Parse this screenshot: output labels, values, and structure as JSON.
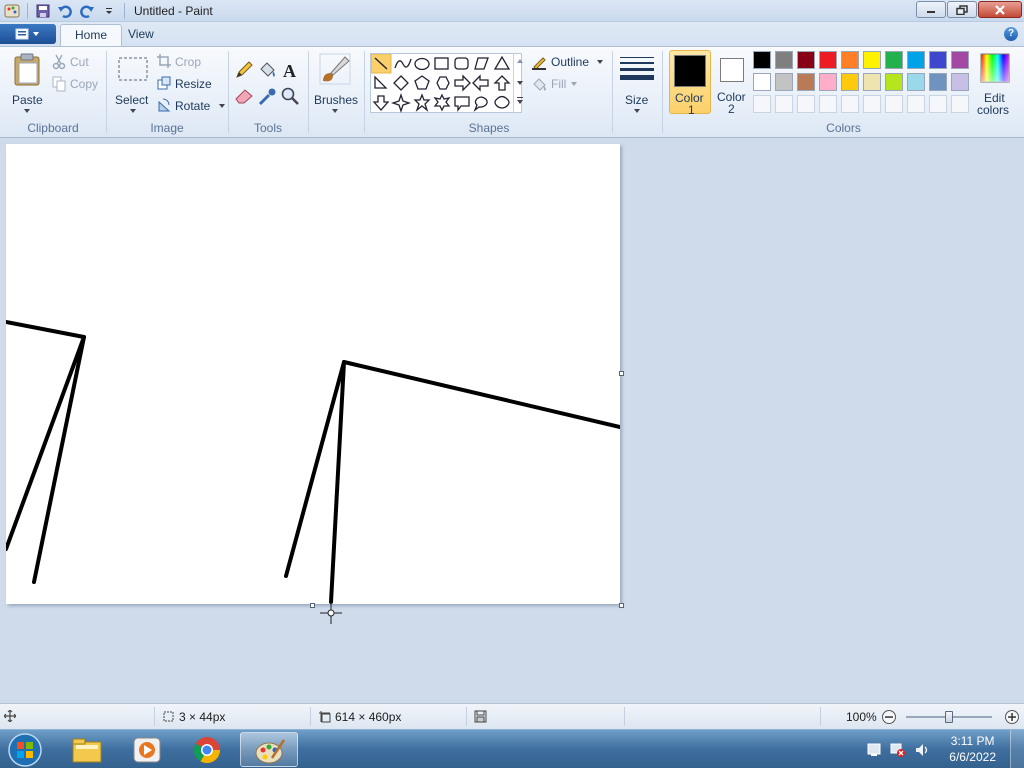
{
  "window": {
    "title": "Untitled - Paint",
    "controls": [
      "minimize-icon",
      "restore-icon",
      "close-icon"
    ]
  },
  "tabs": [
    {
      "label": "Home",
      "active": true
    },
    {
      "label": "View",
      "active": false
    }
  ],
  "ribbon": {
    "clipboard": {
      "label": "Clipboard",
      "paste": "Paste",
      "cut": "Cut",
      "copy": "Copy"
    },
    "image": {
      "label": "Image",
      "select": "Select",
      "crop": "Crop",
      "resize": "Resize",
      "rotate": "Rotate"
    },
    "tools": {
      "label": "Tools",
      "icons": [
        "pencil-icon",
        "fill-icon",
        "text-icon",
        "eraser-icon",
        "color-picker-icon",
        "magnifier-icon"
      ]
    },
    "brushes": {
      "label": "Brushes"
    },
    "shapes": {
      "label": "Shapes",
      "outline": "Outline",
      "fill": "Fill"
    },
    "size": {
      "label": "Size"
    },
    "colors": {
      "label": "Colors",
      "color1": {
        "label_line1": "Color",
        "label_line2": "1",
        "value": "#000000"
      },
      "color2": {
        "label_line1": "Color",
        "label_line2": "2",
        "value": "#ffffff"
      },
      "edit": {
        "label_line1": "Edit",
        "label_line2": "colors"
      },
      "palette_row1": [
        "#000000",
        "#7f7f7f",
        "#880015",
        "#ed1c24",
        "#ff7f27",
        "#fff200",
        "#22b14c",
        "#00a2e8",
        "#3f48cc",
        "#a349a4"
      ],
      "palette_row2": [
        "#ffffff",
        "#c3c3c3",
        "#b97a57",
        "#ffaec9",
        "#ffc90e",
        "#efe4b0",
        "#b5e61d",
        "#99d9ea",
        "#7092be",
        "#c8bfe7"
      ],
      "palette_row3": [
        "#f5f7fa",
        "#f5f7fa",
        "#f5f7fa",
        "#f5f7fa",
        "#f5f7fa",
        "#f5f7fa",
        "#f5f7fa",
        "#f5f7fa",
        "#f5f7fa",
        "#f5f7fa"
      ]
    }
  },
  "status": {
    "selection_size": "3 × 44px",
    "canvas_size": "614 × 460px",
    "zoom": "100%"
  },
  "taskbar": {
    "time": "3:11 PM",
    "date": "6/6/2022",
    "apps": [
      "explorer-icon",
      "media-player-icon",
      "chrome-icon",
      "paint-icon"
    ]
  }
}
